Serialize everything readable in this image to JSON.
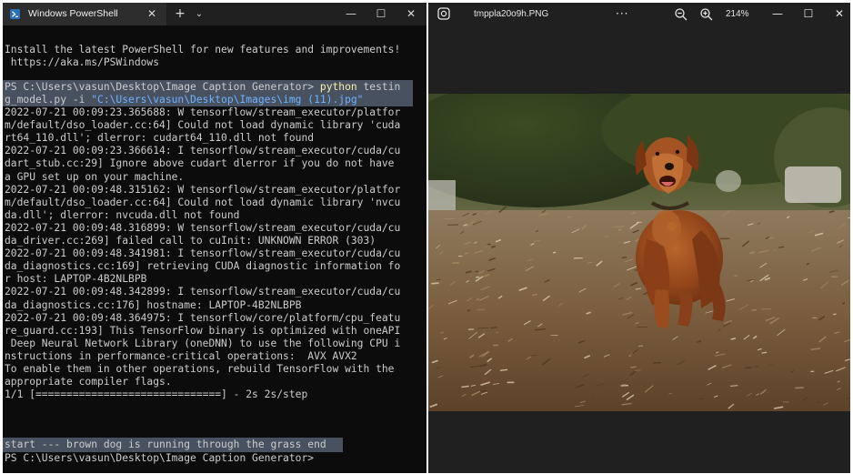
{
  "terminal": {
    "tab_title": "Windows PowerShell",
    "tab_close": "✕",
    "new_tab": "+",
    "dropdown": "⌄",
    "minimize": "—",
    "maximize": "☐",
    "close": "✕",
    "banner": [
      "Install the latest PowerShell for new features and improvements!",
      " https://aka.ms/PSWindows"
    ],
    "prompt": "PS C:\\Users\\vasun\\Desktop\\Image Caption Generator>",
    "command": "python",
    "args_part1": " testin",
    "args_part2": "g_model.py -i ",
    "path_arg": "\"C:\\Users\\vasun\\Desktop\\Images\\img (11).jpg\"",
    "log_lines": [
      "2022-07-21 00:09:23.365688: W tensorflow/stream_executor/platfor",
      "m/default/dso_loader.cc:64] Could not load dynamic library 'cuda",
      "rt64_110.dll'; dlerror: cudart64_110.dll not found",
      "2022-07-21 00:09:23.366614: I tensorflow/stream_executor/cuda/cu",
      "dart_stub.cc:29] Ignore above cudart dlerror if you do not have",
      "a GPU set up on your machine.",
      "2022-07-21 00:09:48.315162: W tensorflow/stream_executor/platfor",
      "m/default/dso_loader.cc:64] Could not load dynamic library 'nvcu",
      "da.dll'; dlerror: nvcuda.dll not found",
      "2022-07-21 00:09:48.316899: W tensorflow/stream_executor/cuda/cu",
      "da_driver.cc:269] failed call to cuInit: UNKNOWN ERROR (303)",
      "2022-07-21 00:09:48.341981: I tensorflow/stream_executor/cuda/cu",
      "da_diagnostics.cc:169] retrieving CUDA diagnostic information fo",
      "r host: LAPTOP-4B2NLBPB",
      "2022-07-21 00:09:48.342899: I tensorflow/stream_executor/cuda/cu",
      "da_diagnostics.cc:176] hostname: LAPTOP-4B2NLBPB",
      "2022-07-21 00:09:48.364975: I tensorflow/core/platform/cpu_featu",
      "re_guard.cc:193] This TensorFlow binary is optimized with oneAPI",
      " Deep Neural Network Library (oneDNN) to use the following CPU i",
      "nstructions in performance-critical operations:  AVX AVX2",
      "To enable them in other operations, rebuild TensorFlow with the",
      "appropriate compiler flags.",
      "1/1 [==============================] - 2s 2s/step"
    ],
    "caption_output": "start --- brown dog is running through the grass end",
    "final_prompt": "PS C:\\Users\\vasun\\Desktop\\Image Caption Generator>"
  },
  "photos": {
    "filename": "tmppla20o9h.PNG",
    "more": "···",
    "zoom": "214%",
    "minimize": "—",
    "maximize": "☐",
    "close": "✕",
    "icons": {
      "app": "photos-app-icon",
      "zoom_out": "zoom-out-icon",
      "zoom_in": "zoom-in-icon"
    },
    "colors": {
      "background": "#202020",
      "selection": "#47515f",
      "command": "#f9f1a5",
      "string": "#6fb2ff"
    }
  }
}
